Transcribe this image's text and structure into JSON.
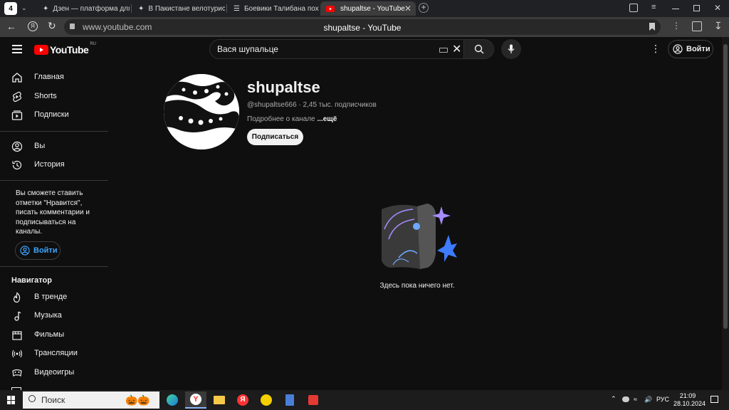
{
  "browser": {
    "tab_count_badge": "4",
    "tabs": [
      {
        "title": "Дзен — платформа для п"
      },
      {
        "title": "В Пакистане велотуриста"
      },
      {
        "title": "Боевики Талибана похити"
      },
      {
        "title": "shupaltse - YouTube"
      }
    ],
    "url": "www.youtube.com",
    "page_title": "shupaltse - YouTube"
  },
  "youtube": {
    "logo_text": "YouTube",
    "region": "RU",
    "search_value": "Вася шупальце",
    "signin_label": "Войти"
  },
  "sidebar": {
    "primary": [
      {
        "label": "Главная",
        "icon": "home-icon"
      },
      {
        "label": "Shorts",
        "icon": "shorts-icon"
      },
      {
        "label": "Подписки",
        "icon": "subscriptions-icon"
      }
    ],
    "secondary": [
      {
        "label": "Вы",
        "icon": "you-icon"
      },
      {
        "label": "История",
        "icon": "history-icon"
      }
    ],
    "promo_text": "Вы сможете ставить отметки \"Нравится\", писать комментарии и подписываться на каналы.",
    "signin_label": "Войти",
    "navigator_title": "Навигатор",
    "navigator": [
      {
        "label": "В тренде",
        "icon": "trending-icon"
      },
      {
        "label": "Музыка",
        "icon": "music-icon"
      },
      {
        "label": "Фильмы",
        "icon": "movies-icon"
      },
      {
        "label": "Трансляции",
        "icon": "live-icon"
      },
      {
        "label": "Видеоигры",
        "icon": "gaming-icon"
      }
    ]
  },
  "channel": {
    "name": "shupaltse",
    "handle": "@shupaltse666",
    "subscribers": "2,45 тыс. подписчиков",
    "about_label": "Подробнее о канале",
    "more_label": "...ещё",
    "subscribe_label": "Подписаться",
    "empty_text": "Здесь пока ничего нет."
  },
  "taskbar": {
    "search_label": "Поиск",
    "lang": "РУС",
    "time": "21:09",
    "date": "28.10.2024"
  },
  "colors": {
    "youtube_red": "#ff0000",
    "link_blue": "#3ea6ff",
    "background": "#0f0f0f"
  }
}
